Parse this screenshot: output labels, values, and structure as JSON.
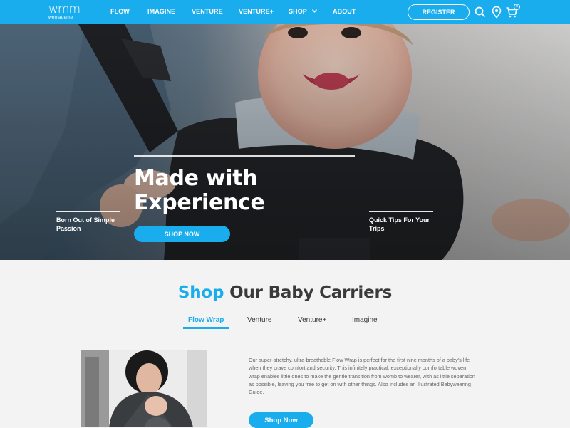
{
  "brand": {
    "logo_mark": "wm",
    "logo_sup": "m",
    "logo_sub": "wemademe"
  },
  "nav": {
    "items": [
      "FLOW",
      "IMAGINE",
      "VENTURE",
      "VENTURE+",
      "SHOP",
      "ABOUT"
    ],
    "register_label": "REGISTER",
    "cart_count": "0",
    "icons": [
      "search-icon",
      "location-icon",
      "cart-icon"
    ]
  },
  "hero": {
    "title_line1": "Made with",
    "title_line2": "Experience",
    "left_caption_line1": "Born Out of Simple",
    "left_caption_line2": "Passion",
    "right_caption_line1": "Quick Tips For Your",
    "right_caption_line2": "Trips",
    "cta_label": "SHOP NOW"
  },
  "shop": {
    "title_accent": "Shop",
    "title_rest": " Our Baby Carriers",
    "tabs": [
      "Flow Wrap",
      "Venture",
      "Venture+",
      "Imagine"
    ],
    "active_tab": "Flow Wrap",
    "description": "Our super-stretchy, ultra-breathable Flow Wrap is perfect for the first nine months of a baby's life when they crave comfort and security. This infinitely practical, exceptionally comfortable woven wrap enables little ones to make the gentle transition from womb to wearer, with as little separation as possible, leaving you free to get on with other things. Also includes an illustrated Babywearing Guide.",
    "cta_label": "Shop Now"
  },
  "colors": {
    "accent": "#19adee",
    "text_dark": "#3a3a3a",
    "text_body": "#666666"
  }
}
